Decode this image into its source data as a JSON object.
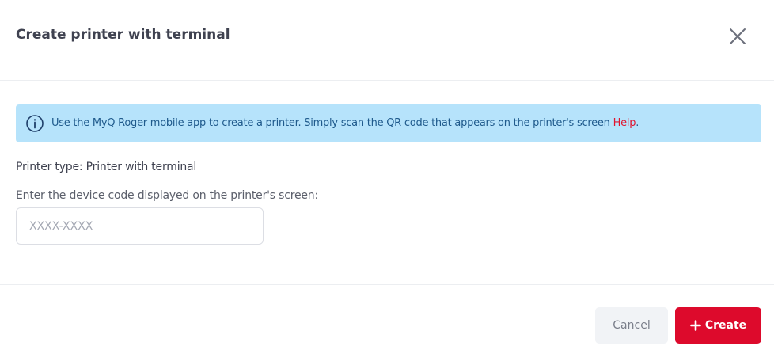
{
  "dialog": {
    "title": "Create printer with terminal",
    "close_icon": "close-icon"
  },
  "alert": {
    "icon": "info-circle-icon",
    "text": "Use the MyQ Roger mobile app to create a printer. Simply scan the QR code that appears on the printer's screen ",
    "link_label": "Help",
    "suffix": ".",
    "background": "#b6e3fb",
    "link_color": "#e0142e"
  },
  "form": {
    "printer_type": "Printer type: Printer with terminal",
    "device_code_label": "Enter the device code displayed on the printer's screen:",
    "device_code_value": "",
    "device_code_placeholder": "XXXX-XXXX"
  },
  "footer": {
    "cancel_label": "Cancel",
    "create_label": "Create",
    "create_icon": "plus-icon",
    "accent": "#dd0a2c"
  }
}
